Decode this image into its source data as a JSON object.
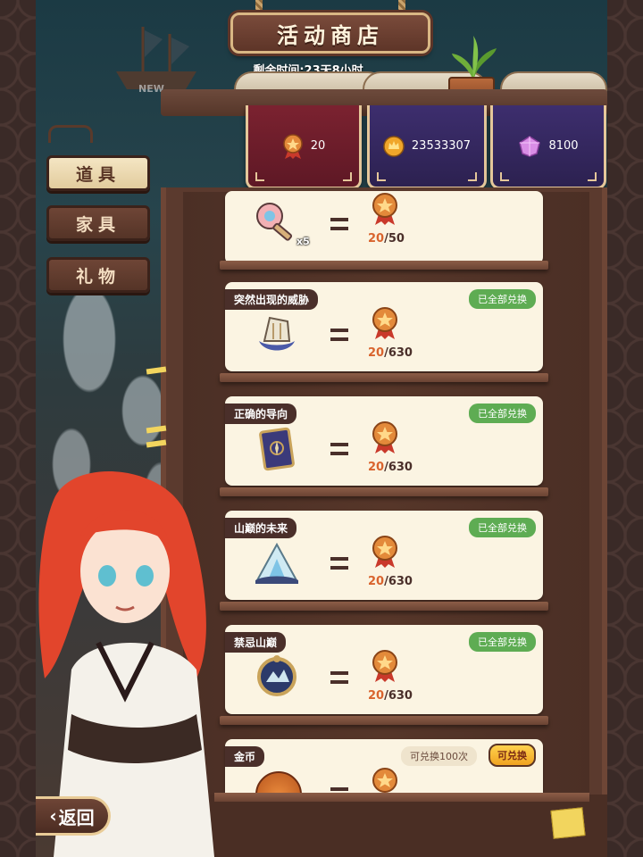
{
  "header": {
    "title": "活动商店",
    "remaining_time": "剩余时间:23天8小时"
  },
  "background": {
    "ship_tag": "NEW"
  },
  "currencies": [
    {
      "icon": "bronze-medal-icon",
      "value": "20",
      "color": "#7b2230"
    },
    {
      "icon": "gold-crown-coin-icon",
      "value": "23533307",
      "color": "#3d2e6e"
    },
    {
      "icon": "pink-gem-icon",
      "value": "8100",
      "color": "#3d2e6e"
    }
  ],
  "menu": [
    {
      "label": "道具",
      "active": true
    },
    {
      "label": "家具",
      "active": false
    },
    {
      "label": "礼物",
      "active": false
    }
  ],
  "items": [
    {
      "name": "",
      "icon": "key-icon",
      "quantity": "x5",
      "cost_current": "20",
      "cost_total": "/50",
      "status": ""
    },
    {
      "name": "突然出现的威胁",
      "icon": "ghost-ship-icon",
      "cost_current": "20",
      "cost_total": "/630",
      "status": "已全部兑换"
    },
    {
      "name": "正确的导向",
      "icon": "compass-book-icon",
      "cost_current": "20",
      "cost_total": "/630",
      "status": "已全部兑换"
    },
    {
      "name": "山巅的未来",
      "icon": "crystal-mountain-icon",
      "cost_current": "20",
      "cost_total": "/630",
      "status": "已全部兑换"
    },
    {
      "name": "禁忌山巅",
      "icon": "ornate-frame-icon",
      "cost_current": "20",
      "cost_total": "/630",
      "status": "已全部兑换"
    },
    {
      "name": "金币",
      "icon": "gold-coin-icon",
      "exchange_limit": "可兑换100次",
      "button": "可兑换"
    }
  ],
  "footer": {
    "back_label": "返回"
  },
  "colors": {
    "accent_green": "#5eac53",
    "cost_orange": "#d9642e",
    "card_bg": "#fbf4e2"
  }
}
